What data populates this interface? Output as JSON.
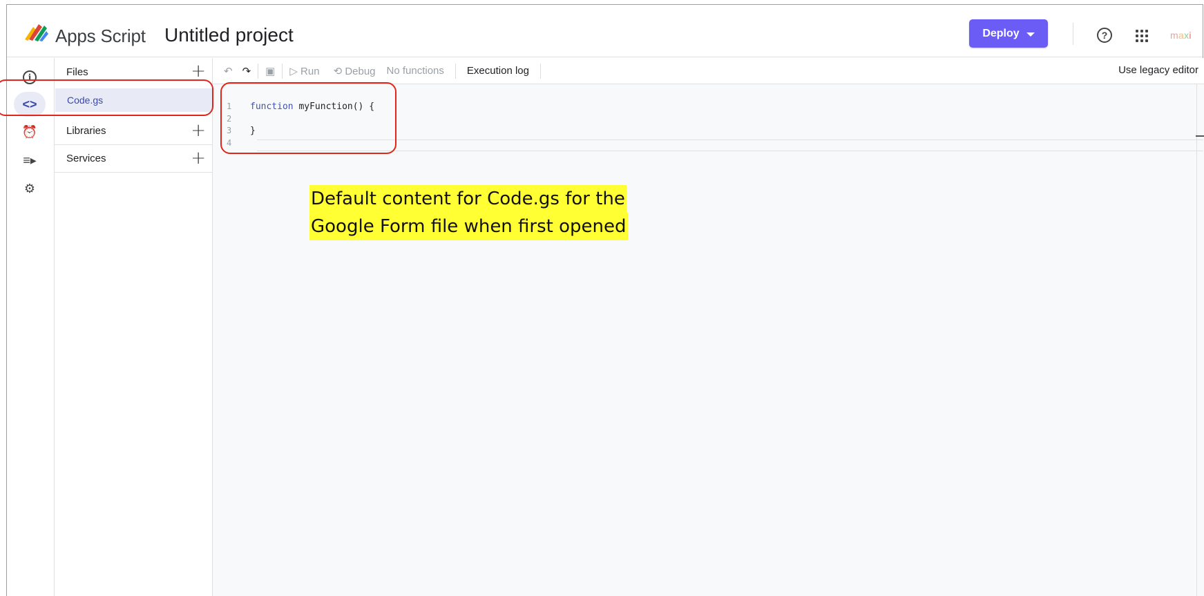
{
  "header": {
    "app_name": "Apps Script",
    "project_title": "Untitled project",
    "deploy_label": "Deploy",
    "help_glyph": "?",
    "account_initials": [
      "m",
      "a",
      "x",
      "i"
    ]
  },
  "rail": {
    "items": [
      {
        "name": "overview-icon",
        "glyph": "i"
      },
      {
        "name": "editor-icon",
        "glyph": "<>"
      },
      {
        "name": "triggers-icon",
        "glyph": "⏰"
      },
      {
        "name": "executions-icon",
        "glyph": "≡▸"
      },
      {
        "name": "settings-icon",
        "glyph": "⚙"
      }
    ]
  },
  "panel": {
    "files_label": "Files",
    "file_name": "Code.gs",
    "libraries_label": "Libraries",
    "services_label": "Services",
    "plus_glyph": "+"
  },
  "toolbar": {
    "undo_glyph": "↶",
    "redo_glyph": "↷",
    "save_glyph": "▣",
    "run_label": "▷ Run",
    "debug_label": "⟲ Debug",
    "functions_label": "No functions",
    "execution_log_label": "Execution log",
    "legacy_label": "Use legacy editor"
  },
  "editor": {
    "line_numbers": [
      "1",
      "2",
      "3",
      "4"
    ],
    "keyword": "function",
    "signature": " myFunction() {",
    "closing": "}"
  },
  "annotation": {
    "line1": "Default content for Code.gs for the",
    "line2": "Google Form file when first opened",
    "highlight_color": "#ffff33",
    "callout_color": "#e0261b"
  },
  "colors": {
    "accent": "#6b5cf6",
    "selected_bg": "#e8eaf6",
    "selected_text": "#3949ab"
  }
}
